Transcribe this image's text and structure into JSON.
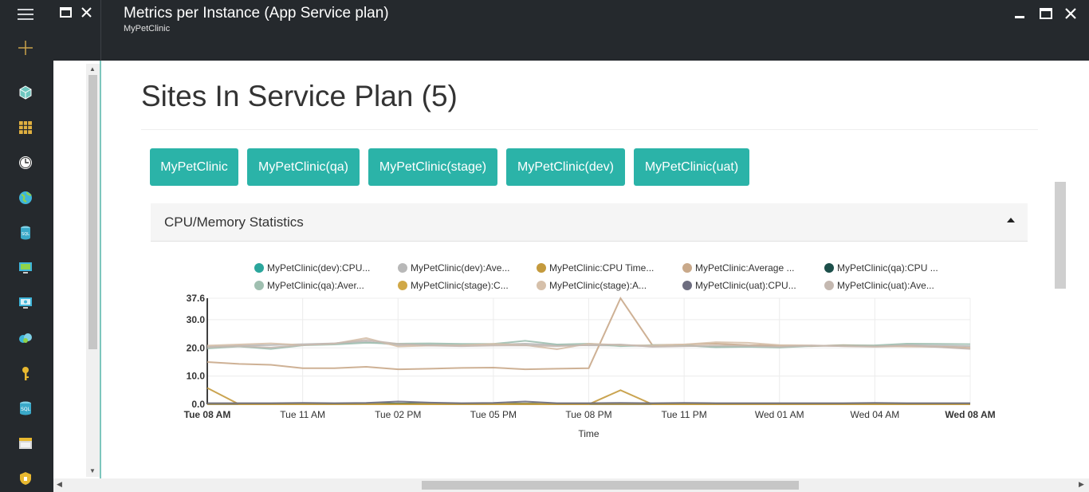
{
  "window": {
    "title": "Metrics per Instance (App Service plan)",
    "subtitle": "MyPetClinic"
  },
  "rail": {
    "icons": [
      "hamburger-icon",
      "plus-icon",
      "cube-icon",
      "grid-icon",
      "clock-icon",
      "globe-icon",
      "sql-database-icon",
      "virtual-machine-icon",
      "monitor-icon",
      "cloud-service-icon",
      "key-icon",
      "sql-icon",
      "storage-icon",
      "shield-icon"
    ]
  },
  "main": {
    "page_title": "Sites In Service Plan (5)",
    "sites": [
      "MyPetClinic",
      "MyPetClinic(qa)",
      "MyPetClinic(stage)",
      "MyPetClinic(dev)",
      "MyPetClinic(uat)"
    ],
    "panel_title": "CPU/Memory Statistics"
  },
  "colors": {
    "accent": "#2bb3a8",
    "chrome": "#25292d"
  },
  "chart_data": {
    "type": "line",
    "xlabel": "Time",
    "ylabel": "",
    "ylim": [
      0,
      37.6
    ],
    "y_ticks": [
      "0.0",
      "10.0",
      "20.0",
      "30.0",
      "37.6"
    ],
    "x_ticks": [
      "Tue 08 AM",
      "Tue 11 AM",
      "Tue 02 PM",
      "Tue 05 PM",
      "Tue 08 PM",
      "Tue 11 PM",
      "Wed 01 AM",
      "Wed 04 AM",
      "Wed 08 AM"
    ],
    "x_tick_hours": [
      0,
      3,
      6,
      9,
      12,
      15,
      18,
      21,
      24
    ],
    "legend_placement": "top",
    "series": [
      {
        "name": "MyPetClinic(dev):CPU...",
        "color": "#2ba69c",
        "x": [
          0,
          1,
          2,
          3,
          4,
          5,
          6,
          7,
          8,
          9,
          10,
          11,
          12,
          13,
          14,
          15,
          16,
          17,
          18,
          19,
          20,
          21,
          22,
          23,
          24
        ],
        "values": [
          0.2,
          0.2,
          0.2,
          0.2,
          0.2,
          0.3,
          0.2,
          0.2,
          0.2,
          0.2,
          0.2,
          0.2,
          0.2,
          0.2,
          0.2,
          0.2,
          0.2,
          0.2,
          0.2,
          0.2,
          0.2,
          0.2,
          0.2,
          0.2,
          0.2
        ]
      },
      {
        "name": "MyPetClinic(dev):Ave...",
        "color": "#b8b8b8",
        "x": [
          0,
          1,
          2,
          3,
          4,
          5,
          6,
          7,
          8,
          9,
          10,
          11,
          12,
          13,
          14,
          15,
          16,
          17,
          18,
          19,
          20,
          21,
          22,
          23,
          24
        ],
        "values": [
          20.5,
          20.8,
          21.0,
          21.3,
          21.6,
          22.2,
          21.0,
          21.2,
          21.0,
          21.2,
          21.5,
          21.0,
          20.9,
          20.8,
          20.6,
          20.8,
          20.4,
          20.6,
          20.8,
          20.7,
          20.9,
          20.6,
          21.0,
          20.8,
          20.6
        ]
      },
      {
        "name": "MyPetClinic:CPU Time...",
        "color": "#c49a3d",
        "x": [
          0,
          1,
          2,
          3,
          4,
          5,
          6,
          7,
          8,
          9,
          10,
          11,
          12,
          13,
          14,
          15,
          16,
          17,
          18,
          19,
          20,
          21,
          22,
          23,
          24
        ],
        "values": [
          5.8,
          0.0,
          0.0,
          0.0,
          0.0,
          0.0,
          0.0,
          0.0,
          0.0,
          0.0,
          0.0,
          0.0,
          0.0,
          5.0,
          0.0,
          0.0,
          0.0,
          0.0,
          0.0,
          0.0,
          0.0,
          0.0,
          0.0,
          0.0,
          0.0
        ]
      },
      {
        "name": "MyPetClinic:Average ...",
        "color": "#c9a98a",
        "x": [
          0,
          1,
          2,
          3,
          4,
          5,
          6,
          7,
          8,
          9,
          10,
          11,
          12,
          13,
          14,
          15,
          16,
          17,
          18,
          19,
          20,
          21,
          22,
          23,
          24
        ],
        "values": [
          15.0,
          14.3,
          14.0,
          12.8,
          12.8,
          13.3,
          12.4,
          12.6,
          12.9,
          13.0,
          12.4,
          12.6,
          12.8,
          37.6,
          21.0,
          21.2,
          21.5,
          21.0,
          20.8,
          20.6,
          21.0,
          20.8,
          20.5,
          20.4,
          20.0
        ]
      },
      {
        "name": "MyPetClinic(qa):CPU ...",
        "color": "#1c4f4a",
        "x": [
          0,
          1,
          2,
          3,
          4,
          5,
          6,
          7,
          8,
          9,
          10,
          11,
          12,
          13,
          14,
          15,
          16,
          17,
          18,
          19,
          20,
          21,
          22,
          23,
          24
        ],
        "values": [
          0.3,
          0.3,
          0.3,
          0.3,
          0.3,
          0.3,
          0.3,
          0.3,
          0.3,
          0.3,
          0.3,
          0.3,
          0.3,
          0.3,
          0.3,
          0.3,
          0.3,
          0.3,
          0.3,
          0.3,
          0.3,
          0.3,
          0.3,
          0.3,
          0.3
        ]
      },
      {
        "name": "MyPetClinic(qa):Aver...",
        "color": "#9fbfb0",
        "x": [
          0,
          1,
          2,
          3,
          4,
          5,
          6,
          7,
          8,
          9,
          10,
          11,
          12,
          13,
          14,
          15,
          16,
          17,
          18,
          19,
          20,
          21,
          22,
          23,
          24
        ],
        "values": [
          19.8,
          20.5,
          19.6,
          20.9,
          21.2,
          21.8,
          21.5,
          21.6,
          21.4,
          21.4,
          22.5,
          21.2,
          21.5,
          20.6,
          21.0,
          20.9,
          20.2,
          20.4,
          20.1,
          20.7,
          20.8,
          20.9,
          21.5,
          21.4,
          21.3
        ]
      },
      {
        "name": "MyPetClinic(stage):C...",
        "color": "#d0a847",
        "x": [
          0,
          1,
          2,
          3,
          4,
          5,
          6,
          7,
          8,
          9,
          10,
          11,
          12,
          13,
          14,
          15,
          16,
          17,
          18,
          19,
          20,
          21,
          22,
          23,
          24
        ],
        "values": [
          0.1,
          0.1,
          0.1,
          0.1,
          0.1,
          0.1,
          0.1,
          0.1,
          0.1,
          0.1,
          0.2,
          0.1,
          0.1,
          0.1,
          0.1,
          0.1,
          0.1,
          0.1,
          0.1,
          0.1,
          0.1,
          0.1,
          0.1,
          0.1,
          0.1
        ]
      },
      {
        "name": "MyPetClinic(stage):A...",
        "color": "#d6c0aa",
        "x": [
          0,
          1,
          2,
          3,
          4,
          5,
          6,
          7,
          8,
          9,
          10,
          11,
          12,
          13,
          14,
          15,
          16,
          17,
          18,
          19,
          20,
          21,
          22,
          23,
          24
        ],
        "values": [
          20.8,
          21.2,
          21.6,
          21.0,
          21.5,
          23.5,
          20.5,
          20.8,
          20.9,
          21.4,
          21.0,
          19.5,
          21.5,
          21.0,
          20.8,
          21.2,
          22.0,
          21.8,
          21.0,
          20.9,
          20.6,
          20.4,
          20.6,
          20.4,
          19.8
        ]
      },
      {
        "name": "MyPetClinic(uat):CPU...",
        "color": "#6d6d7f",
        "x": [
          0,
          1,
          2,
          3,
          4,
          5,
          6,
          7,
          8,
          9,
          10,
          11,
          12,
          13,
          14,
          15,
          16,
          17,
          18,
          19,
          20,
          21,
          22,
          23,
          24
        ],
        "values": [
          0.4,
          0.4,
          0.4,
          0.5,
          0.4,
          0.5,
          1.0,
          0.6,
          0.4,
          0.5,
          1.0,
          0.4,
          0.4,
          0.5,
          0.4,
          0.5,
          0.4,
          0.4,
          0.4,
          0.4,
          0.4,
          0.5,
          0.4,
          0.4,
          0.4
        ]
      },
      {
        "name": "MyPetClinic(uat):Ave...",
        "color": "#c4b8b0",
        "x": [
          0,
          1,
          2,
          3,
          4,
          5,
          6,
          7,
          8,
          9,
          10,
          11,
          12,
          13,
          14,
          15,
          16,
          17,
          18,
          19,
          20,
          21,
          22,
          23,
          24
        ],
        "values": [
          20.2,
          20.6,
          20.1,
          21.0,
          21.6,
          22.8,
          21.4,
          20.8,
          20.6,
          20.8,
          20.9,
          20.6,
          21.0,
          21.2,
          20.4,
          20.6,
          20.8,
          20.7,
          20.4,
          20.8,
          20.6,
          20.5,
          20.9,
          20.3,
          19.6
        ]
      }
    ]
  }
}
